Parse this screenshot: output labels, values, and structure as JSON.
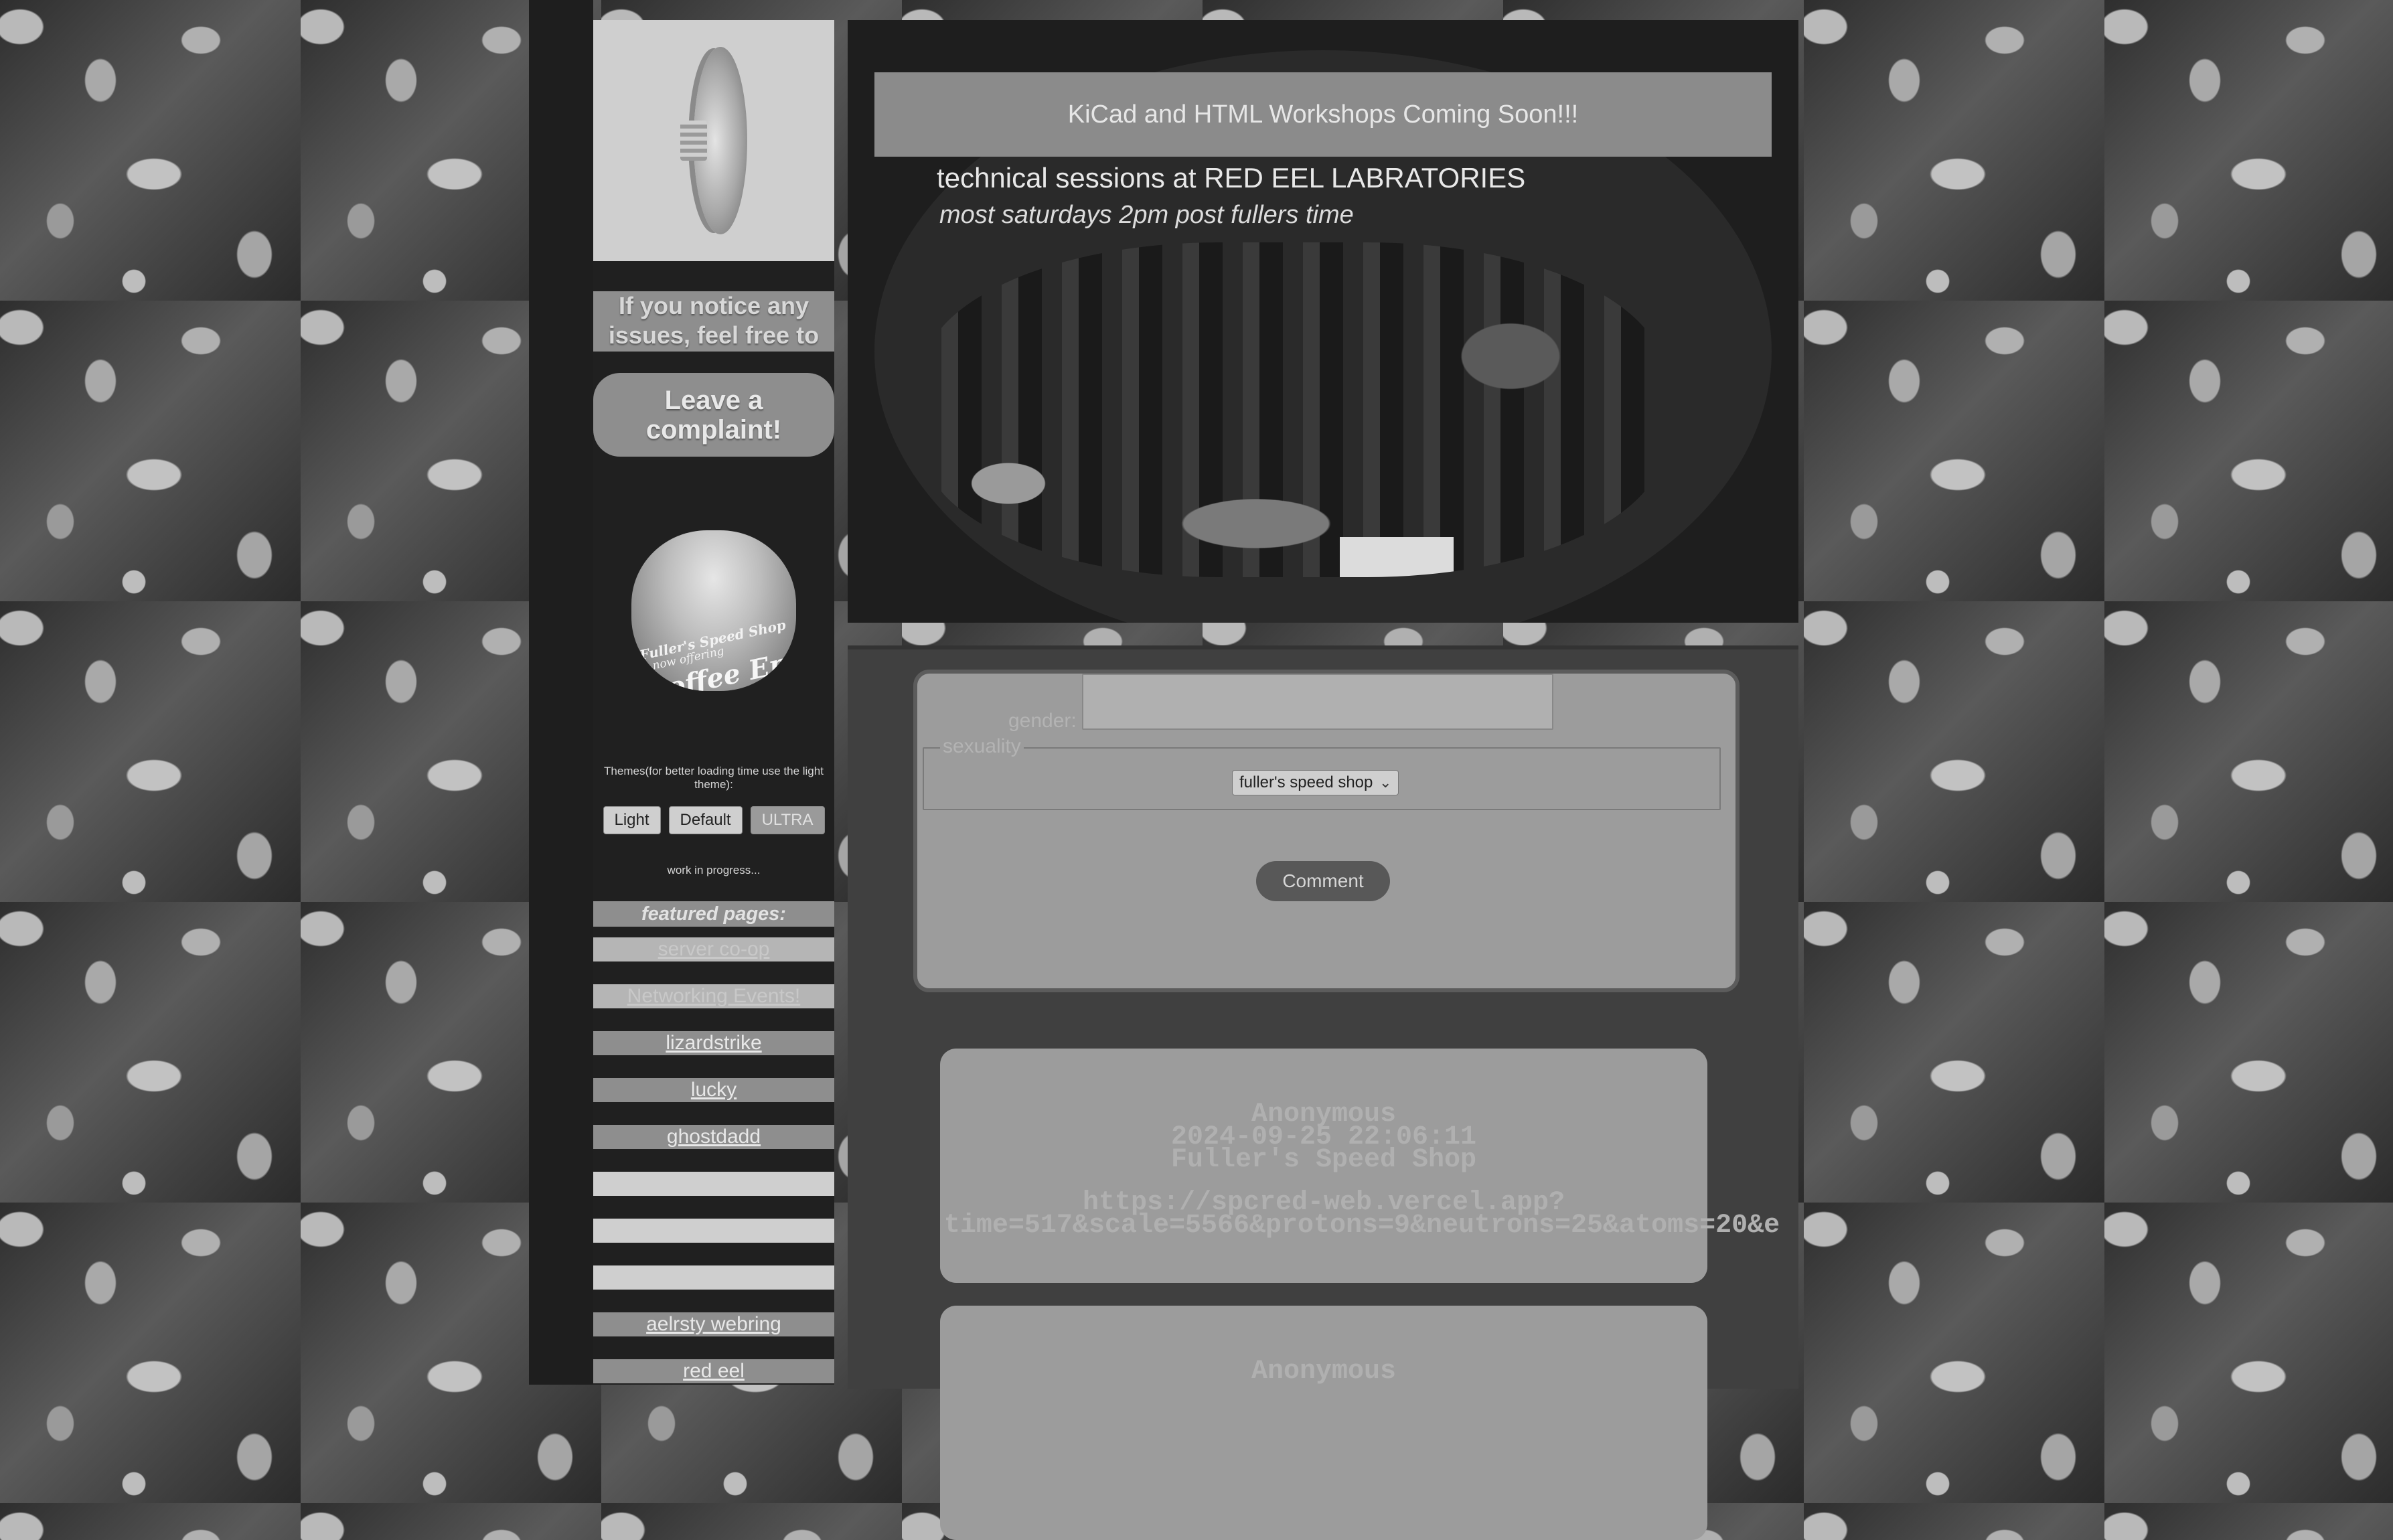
{
  "sidebar": {
    "notice": "If you notice any issues, feel free to",
    "complaint_button": "Leave a complaint!",
    "ad": {
      "line1": "Fuller's Speed Shop",
      "line2": "is now offering",
      "line3": "Coffee Enema"
    },
    "themes_label": "Themes(for better loading time use the light theme):",
    "themes": [
      "Light",
      "Default",
      "ULTRA"
    ],
    "wip": "work in progress...",
    "featured_heading": "featured pages:",
    "links": [
      {
        "label": "server co-op"
      },
      {
        "label": "Networking Events!"
      },
      {
        "label": "lizardstrike"
      },
      {
        "label": "lucky"
      },
      {
        "label": "ghostdadd"
      },
      {
        "label": "aelrsty webring"
      },
      {
        "label": "red eel"
      }
    ]
  },
  "banner": {
    "title": "KiCad and HTML Workshops Coming Soon!!!",
    "subtitle": "technical sessions at RED EEL LABRATORIES",
    "schedule": "most saturdays 2pm post fullers time"
  },
  "form": {
    "gender_label": "gender:",
    "sexuality_legend": "sexuality",
    "select_value": "fuller's speed shop",
    "submit_label": "Comment"
  },
  "comments": [
    {
      "author": "Anonymous",
      "timestamp": "2024-09-25 22:06:11",
      "location": "Fuller's Speed Shop",
      "url_line1": "https://spcred-web.vercel.app?",
      "url_line2": "time=517&scale=5566&protons=9&neutrons=25&atoms=20&e"
    },
    {
      "author": "Anonymous"
    }
  ]
}
